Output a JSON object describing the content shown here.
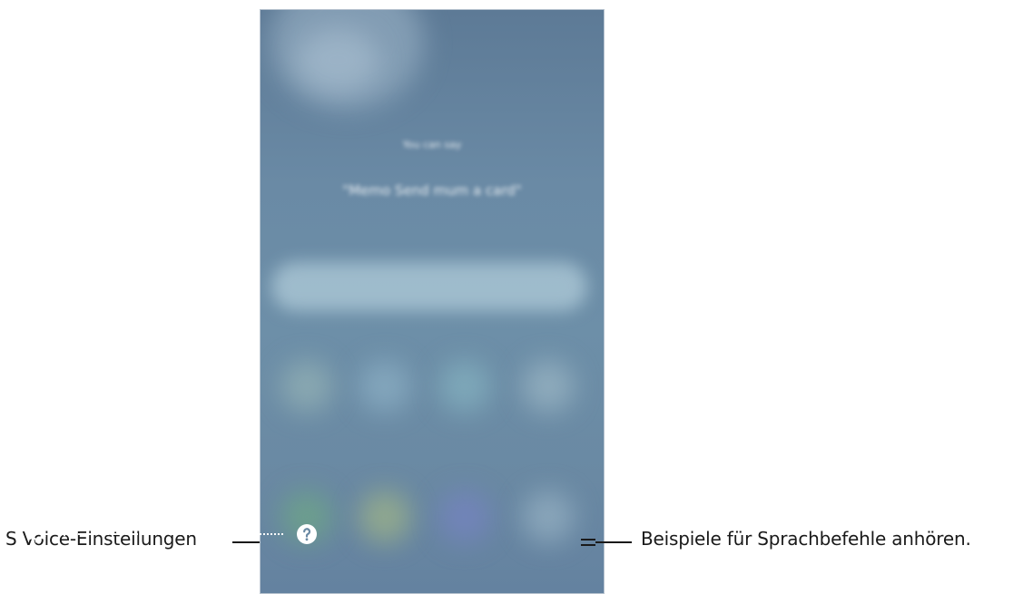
{
  "screen": {
    "hint_title": "You can say",
    "hint_example": "\"Memo Send mum a card\""
  },
  "callouts": {
    "left": "S Voice-Einstellungen",
    "right": "Beispiele für Sprachbefehle anhören."
  },
  "bottom_bar": {
    "settings_icon": "gear-icon",
    "help_icon": "help-icon"
  },
  "colors": {
    "screen_background": "#6a8aa5",
    "label_text": "#1a1a1a"
  }
}
